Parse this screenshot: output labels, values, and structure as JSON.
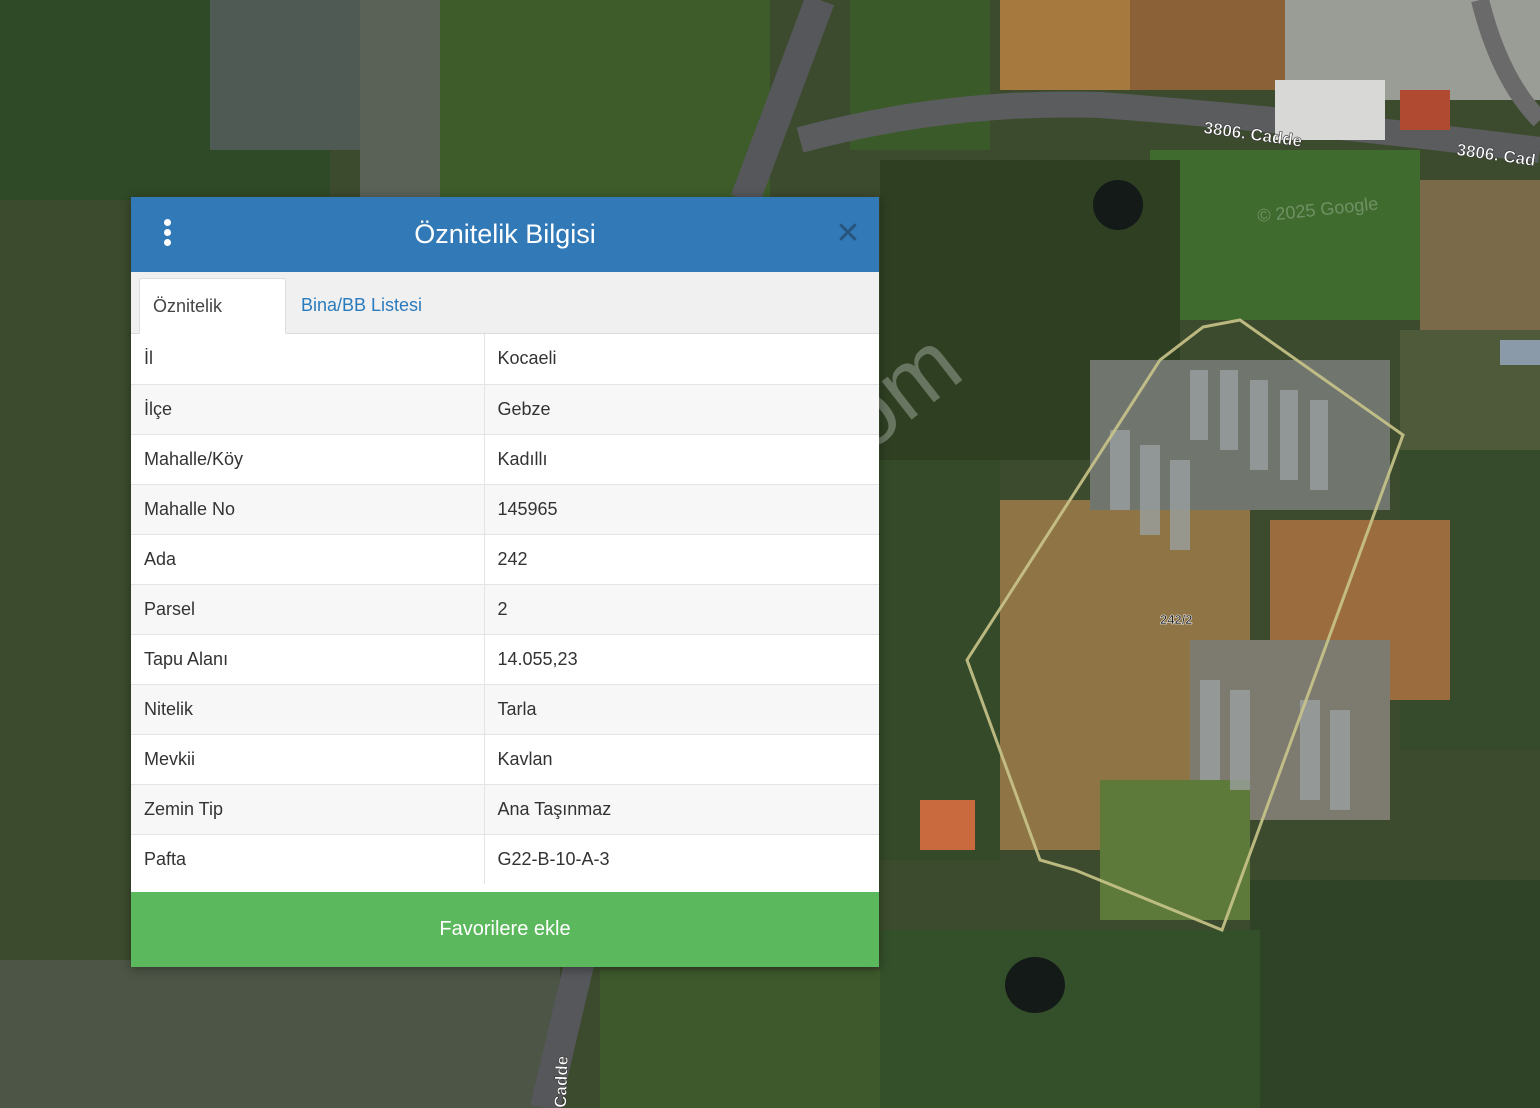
{
  "popup": {
    "title": "Öznitelik Bilgisi",
    "tabs": [
      {
        "label": "Öznitelik Bilgisi",
        "active": true
      },
      {
        "label": "Bina/BB Listesi",
        "active": false
      }
    ],
    "rows": [
      {
        "key": "İl",
        "value": "Kocaeli"
      },
      {
        "key": "İlçe",
        "value": "Gebze"
      },
      {
        "key": "Mahalle/Köy",
        "value": "Kadıllı"
      },
      {
        "key": "Mahalle No",
        "value": "145965"
      },
      {
        "key": "Ada",
        "value": "242"
      },
      {
        "key": "Parsel",
        "value": "2"
      },
      {
        "key": "Tapu Alanı",
        "value": "14.055,23"
      },
      {
        "key": "Nitelik",
        "value": "Tarla"
      },
      {
        "key": "Mevkii",
        "value": "Kavlan"
      },
      {
        "key": "Zemin Tip",
        "value": "Ana Taşınmaz"
      },
      {
        "key": "Pafta",
        "value": "G22-B-10-A-3"
      }
    ],
    "favorite_button_label": "Favorilere ekle",
    "icons": {
      "menu": "vertical-dots-icon",
      "close": "close-icon"
    },
    "colors": {
      "header": "#3279b7",
      "button": "#5cb85c",
      "tab_link": "#2a7bbd"
    }
  },
  "map": {
    "parcel_label": "242/2",
    "road_labels": [
      "3806. Cadde",
      "3806. Cad",
      "Cadde"
    ],
    "watermark": "emlakjet.com",
    "attribution": "© 2025 Google"
  }
}
